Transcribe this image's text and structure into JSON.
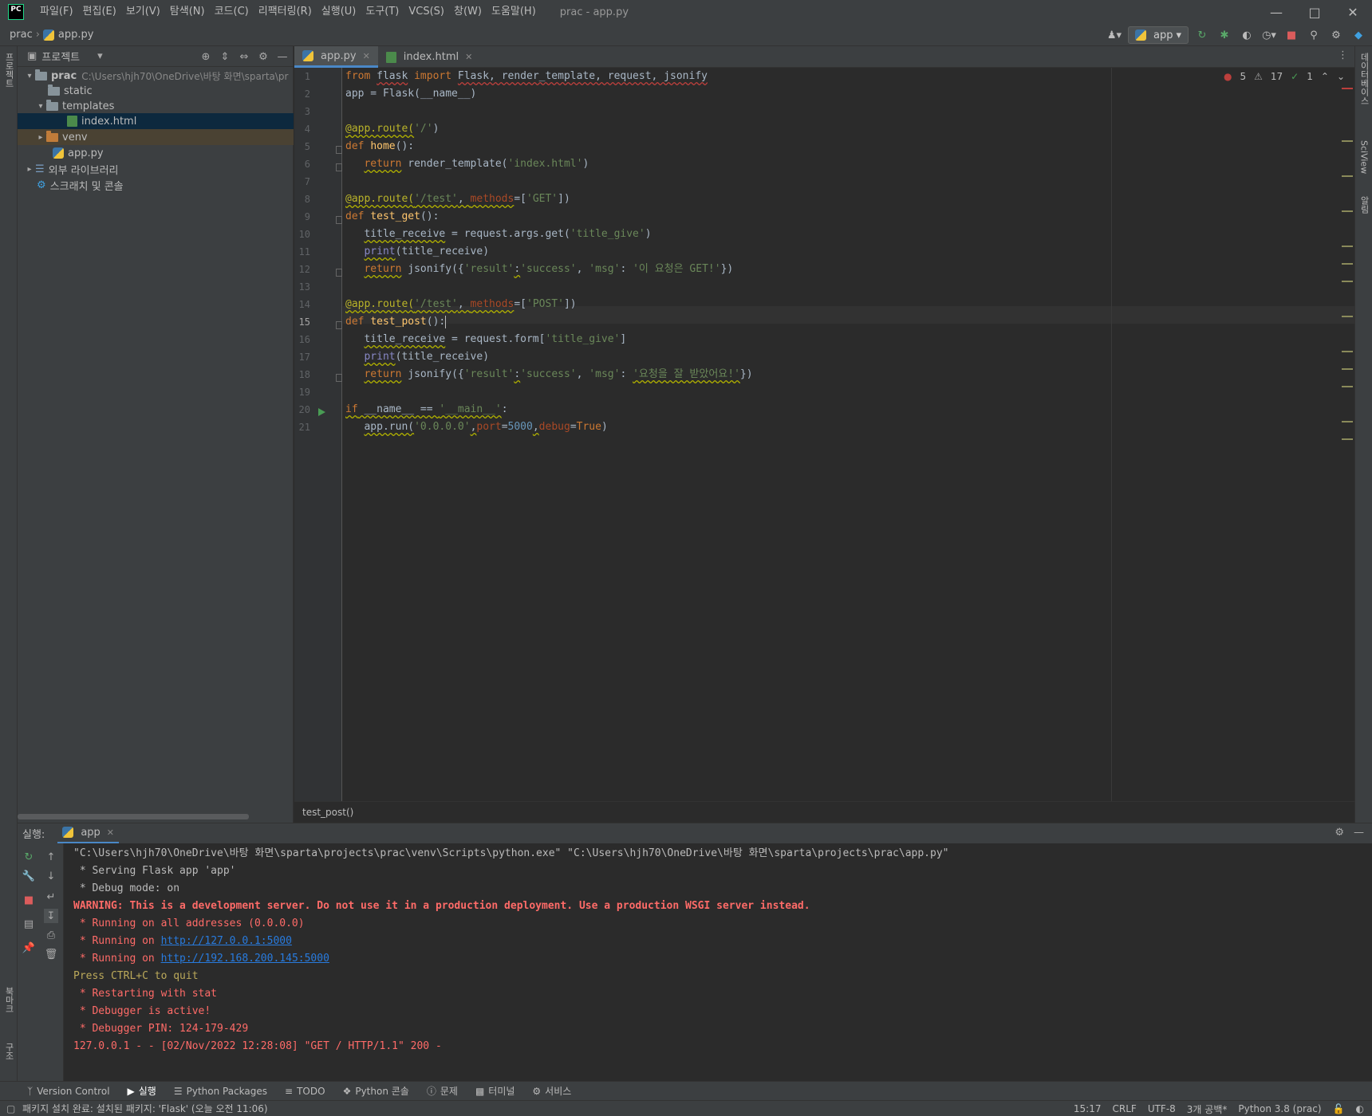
{
  "app": {
    "logo": "PC",
    "window_title": "prac - app.py",
    "menu": [
      "파일(F)",
      "편집(E)",
      "보기(V)",
      "탐색(N)",
      "코드(C)",
      "리팩터링(R)",
      "실행(U)",
      "도구(T)",
      "VCS(S)",
      "창(W)",
      "도움말(H)"
    ]
  },
  "breadcrumb": {
    "project": "prac",
    "file": "app.py"
  },
  "toolbar": {
    "run_config": "app"
  },
  "left_stripe": {
    "project_tab": "프로젝트",
    "bookmarks_tab": "북마크",
    "structure_tab": "구조"
  },
  "right_stripe": {
    "db_tab": "데이터베이스",
    "sciview_tab": "SciView",
    "notifications_tab": "알림"
  },
  "project_panel": {
    "title": "프로젝트",
    "root": {
      "name": "prac",
      "path": "C:\\Users\\hjh70\\OneDrive\\바탕 화면\\sparta\\pr"
    },
    "items": [
      "static",
      "templates",
      "index.html",
      "venv",
      "app.py",
      "외부 라이브러리",
      "스크래치 및 콘솔"
    ]
  },
  "editor": {
    "tabs": [
      "app.py",
      "index.html"
    ],
    "line_numbers": [
      "1",
      "2",
      "3",
      "4",
      "5",
      "6",
      "7",
      "8",
      "9",
      "10",
      "11",
      "12",
      "13",
      "14",
      "15",
      "16",
      "17",
      "18",
      "19",
      "20",
      "21"
    ],
    "inspection": {
      "errors": "5",
      "warnings": "17",
      "ok": "1"
    },
    "code": {
      "l1_from": "from",
      "l1_mod": "flask",
      "l1_import": "import",
      "l1_rest": "Flask, render_template, request, jsonify",
      "l2": "app = Flask(__name__)",
      "l4_dec": "@app.route(",
      "l4_str": "'/'",
      "l4_end": ")",
      "l5_def": "def",
      "l5_fn": "home",
      "l5_end": "():",
      "l6_ret": "return",
      "l6_a": "render_template(",
      "l6_str": "'index.html'",
      "l6_end": ")",
      "l8_dec": "@app.route(",
      "l8_str": "'/test'",
      "l8_b": ", ",
      "l8_prm": "methods",
      "l8_c": "=[",
      "l8_str2": "'GET'",
      "l8_end": "])",
      "l9_def": "def",
      "l9_fn": "test_get",
      "l9_end": "():",
      "l10_var": "title_receive",
      "l10_a": " = request.args.get(",
      "l10_str": "'title_give'",
      "l10_end": ")",
      "l11_bi": "print",
      "l11_rest": "(title_receive)",
      "l12_ret": "return",
      "l12_a": " jsonify({",
      "l12_s1": "'result'",
      "l12_b": ":",
      "l12_s2": "'success'",
      "l12_c": ", ",
      "l12_s3": "'msg'",
      "l12_d": ": ",
      "l12_s4": "'이 요청은 GET!'",
      "l12_end": "})",
      "l14_dec": "@app.route(",
      "l14_str": "'/test'",
      "l14_b": ", ",
      "l14_prm": "methods",
      "l14_c": "=[",
      "l14_str2": "'POST'",
      "l14_end": "])",
      "l15_def": "def",
      "l15_fn": "test_post",
      "l15_end": "():",
      "l16_var": "title_receive",
      "l16_a": " = request.form[",
      "l16_str": "'title_give'",
      "l16_end": "]",
      "l17_bi": "print",
      "l17_rest": "(title_receive)",
      "l18_ret": "return",
      "l18_a": " jsonify({",
      "l18_s1": "'result'",
      "l18_b": ":",
      "l18_s2": "'success'",
      "l18_c": ", ",
      "l18_s3": "'msg'",
      "l18_d": ": ",
      "l18_s4": "'요청을 잘 받았어요!'",
      "l18_end": "})",
      "l20_if": "if",
      "l20_a": " __name__ == ",
      "l20_str": "'__main__'",
      "l20_end": ":",
      "l21_a": "app.run(",
      "l21_str": "'0.0.0.0'",
      "l21_b": ",",
      "l21_prm": "port",
      "l21_c": "=",
      "l21_num": "5000",
      "l21_d": ",",
      "l21_prm2": "debug",
      "l21_e": "=",
      "l21_kw": "True",
      "l21_end": ")"
    },
    "breadcrumb": "test_post()"
  },
  "run_panel": {
    "label": "실행:",
    "tab": "app",
    "console": {
      "c1": "\"C:\\Users\\hjh70\\OneDrive\\바탕 화면\\sparta\\projects\\prac\\venv\\Scripts\\python.exe\" \"C:\\Users\\hjh70\\OneDrive\\바탕 화면\\sparta\\projects\\prac\\app.py\"",
      "c2": " * Serving Flask app 'app'",
      "c3": " * Debug mode: on",
      "c4": "WARNING: This is a development server. Do not use it in a production deployment. Use a production WSGI server instead.",
      "c5": " * Running on all addresses (0.0.0.0)",
      "c6_pre": " * Running on ",
      "c6_link": "http://127.0.0.1:5000",
      "c7_pre": " * Running on ",
      "c7_link": "http://192.168.200.145:5000",
      "c8": "Press CTRL+C to quit",
      "c9": " * Restarting with stat",
      "c10": " * Debugger is active!",
      "c11": " * Debugger PIN: 124-179-429",
      "c12": "127.0.0.1 - - [02/Nov/2022 12:28:08] \"GET / HTTP/1.1\" 200 -"
    }
  },
  "bottom_tools": [
    "Version Control",
    "실행",
    "Python Packages",
    "TODO",
    "Python 콘솔",
    "문제",
    "터미널",
    "서비스"
  ],
  "status": {
    "message": "패키지 설치 완료: 설치된 패키지: 'Flask' (오늘 오전 11:06)",
    "position": "15:17",
    "line_sep": "CRLF",
    "encoding": "UTF-8",
    "indent": "3개 공백*",
    "interpreter": "Python 3.8 (prac)"
  }
}
